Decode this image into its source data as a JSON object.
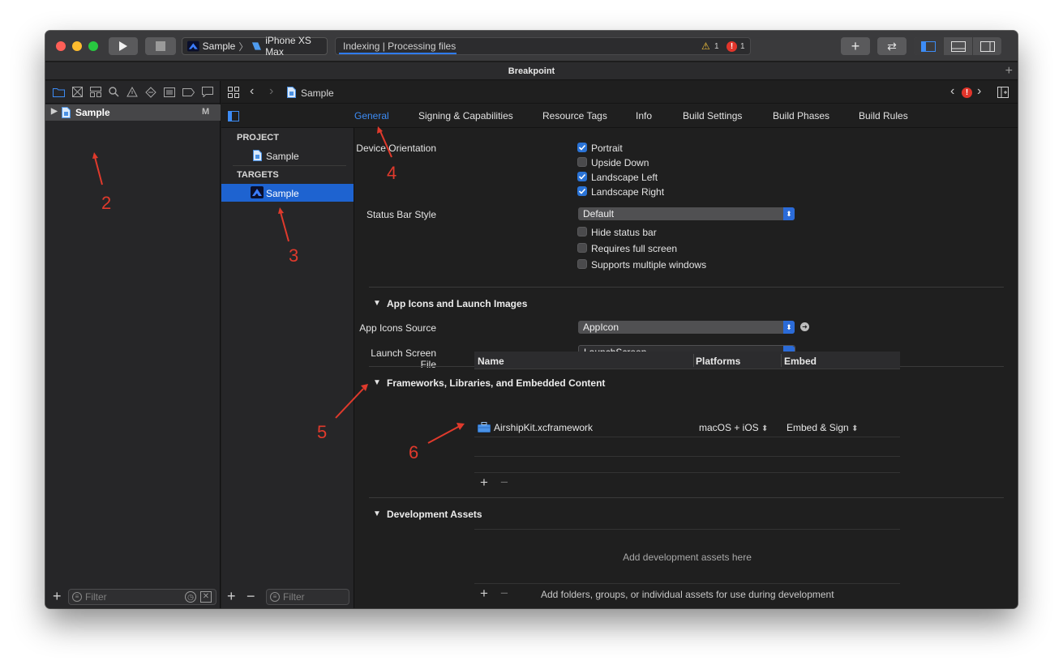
{
  "toolbar": {
    "scheme_app": "Sample",
    "scheme_device": "iPhone XS Max",
    "activity_text": "Indexing | Processing files",
    "warnings_count": "1",
    "errors_count": "1"
  },
  "tab_title": "Breakpoint",
  "navigator": {
    "project_name": "Sample",
    "scm_status": "M",
    "filter_placeholder": "Filter"
  },
  "jumpbar": {
    "file": "Sample"
  },
  "tabs": [
    {
      "label": "General"
    },
    {
      "label": "Signing & Capabilities"
    },
    {
      "label": "Resource Tags"
    },
    {
      "label": "Info"
    },
    {
      "label": "Build Settings"
    },
    {
      "label": "Build Phases"
    },
    {
      "label": "Build Rules"
    }
  ],
  "targets_panel": {
    "project_header": "PROJECT",
    "project_item": "Sample",
    "targets_header": "TARGETS",
    "target_item": "Sample",
    "filter_placeholder": "Filter"
  },
  "deployment": {
    "device_orientation_label": "Device Orientation",
    "orientations": [
      {
        "label": "Portrait",
        "checked": true
      },
      {
        "label": "Upside Down",
        "checked": false
      },
      {
        "label": "Landscape Left",
        "checked": true
      },
      {
        "label": "Landscape Right",
        "checked": true
      }
    ],
    "status_bar_style_label": "Status Bar Style",
    "status_bar_style_value": "Default",
    "status_options": [
      {
        "label": "Hide status bar",
        "checked": false
      },
      {
        "label": "Requires full screen",
        "checked": false
      },
      {
        "label": "Supports multiple windows",
        "checked": false
      }
    ]
  },
  "app_icons": {
    "title": "App Icons and Launch Images",
    "source_label": "App Icons Source",
    "source_value": "AppIcon",
    "launch_label": "Launch Screen File",
    "launch_value": "LaunchScreen"
  },
  "frameworks": {
    "title": "Frameworks, Libraries, and Embedded Content",
    "columns": [
      "Name",
      "Platforms",
      "Embed"
    ],
    "rows": [
      {
        "name": "AirshipKit.xcframework",
        "platforms": "macOS + iOS",
        "embed": "Embed & Sign"
      }
    ]
  },
  "dev_assets": {
    "title": "Development Assets",
    "placeholder": "Add development assets here",
    "hint": "Add folders, groups, or individual assets for use during development"
  },
  "annotations": [
    "2",
    "3",
    "4",
    "5",
    "6"
  ],
  "colors": {
    "accent": "#2a73d6",
    "annotation": "#e03a2c",
    "selection": "#1e63d0"
  }
}
